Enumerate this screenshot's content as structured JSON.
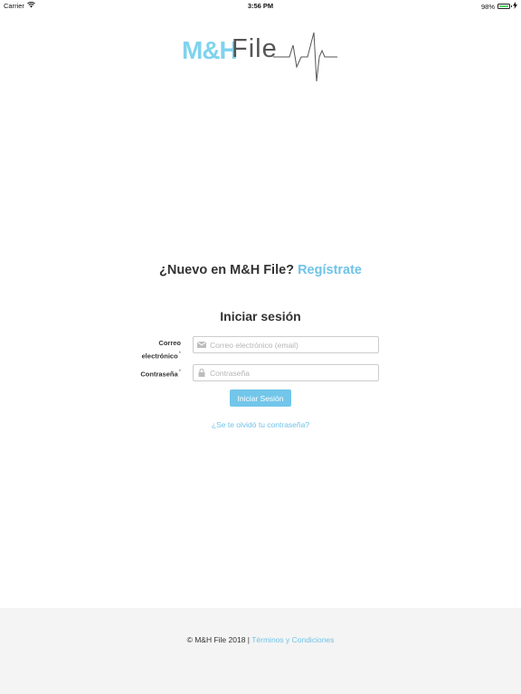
{
  "status_bar": {
    "carrier": "Carrier",
    "time": "3:56 PM",
    "battery": "98%",
    "battery_level": 0.98,
    "icons": [
      "wifi-icon",
      "battery-icon",
      "charging-icon"
    ]
  },
  "logo": {
    "mh": "M&H",
    "file": "File"
  },
  "register": {
    "prompt": "¿Nuevo en M&H File?",
    "link": "Regístrate"
  },
  "login": {
    "title": "Iniciar sesión",
    "email_label_line1": "Correo",
    "email_label_line2": "electrónico",
    "required_mark": "*",
    "email_placeholder": "Correo electrónico (email)",
    "email_value": "",
    "password_label": "Contraseña",
    "password_placeholder": "Contraseña",
    "password_value": "",
    "submit_label": "Iniciar Sesión",
    "forgot_link": "¿Se te olvidó tu contraseña?"
  },
  "footer": {
    "copyright": "© M&H File 2018 |",
    "terms_link": "Términos y Condiciones"
  },
  "colors": {
    "accent": "#72c6ea",
    "logo_accent": "#7fd3ee",
    "footer_bg": "#f4f4f4",
    "text": "#333333"
  }
}
